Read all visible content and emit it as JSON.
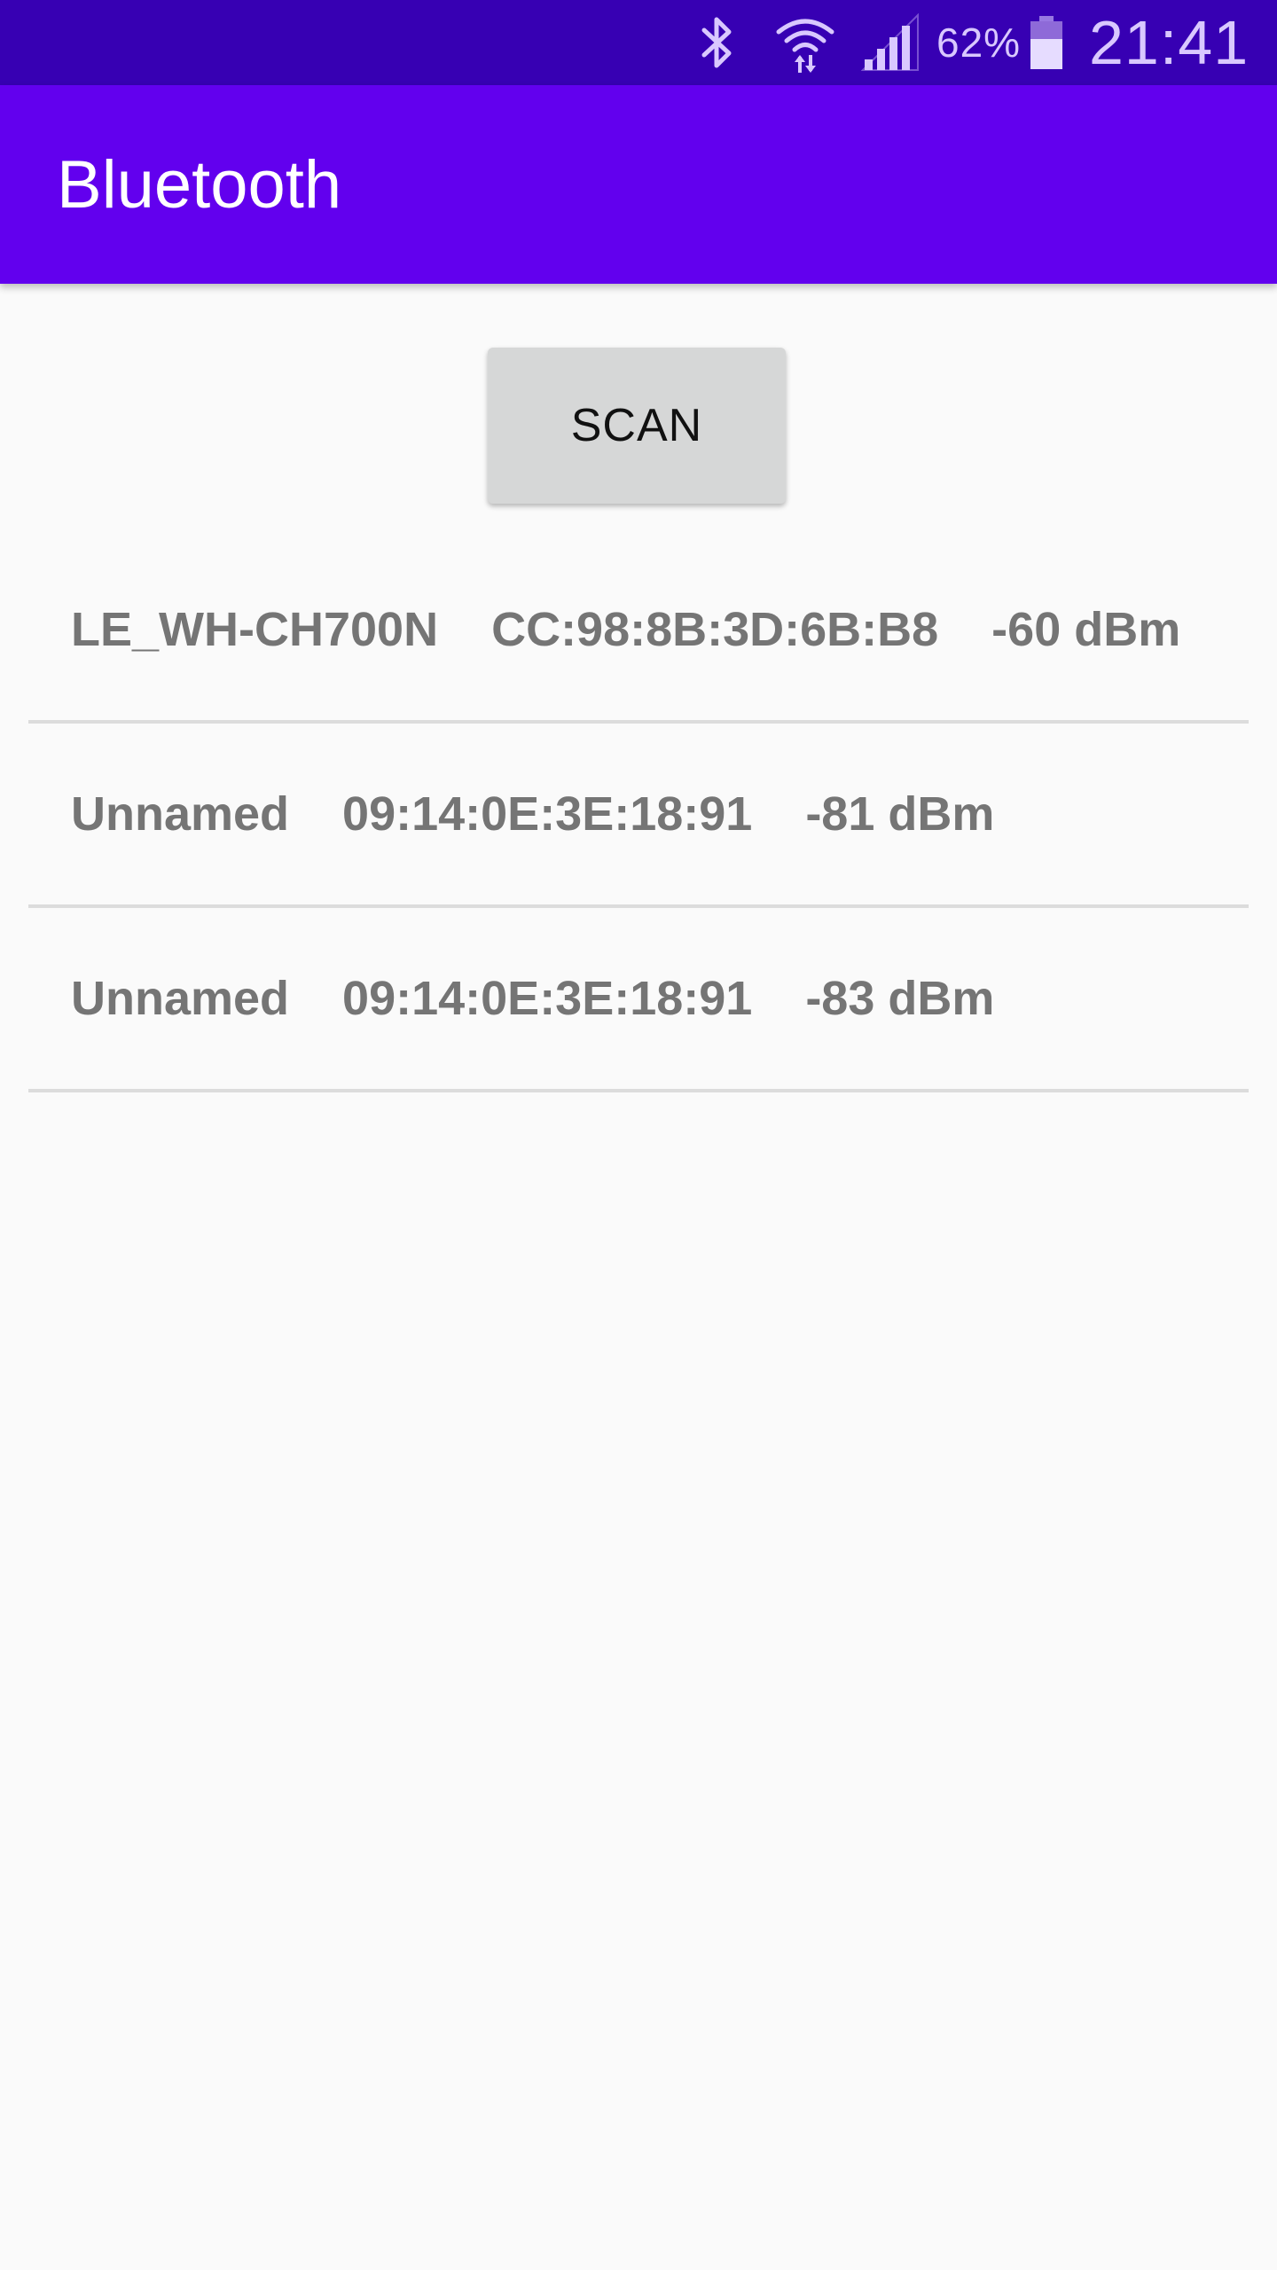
{
  "status_bar": {
    "icons": [
      "bluetooth-icon",
      "wifi-icon",
      "signal-icon",
      "battery-icon"
    ],
    "battery_percent": "62%",
    "time": "21:41"
  },
  "app_bar": {
    "title": "Bluetooth"
  },
  "scan_button": {
    "label": "SCAN"
  },
  "devices": [
    {
      "text": "LE_WH-CH700N    CC:98:8B:3D:6B:B8    -60 dBm"
    },
    {
      "text": "Unnamed    09:14:0E:3E:18:91    -81 dBm"
    },
    {
      "text": "Unnamed    09:14:0E:3E:18:91    -83 dBm"
    }
  ],
  "colors": {
    "status_bar": "#3700b3",
    "app_bar": "#6200ee",
    "background": "#fafafa",
    "button": "#d6d7d7",
    "device_text": "#757575"
  }
}
